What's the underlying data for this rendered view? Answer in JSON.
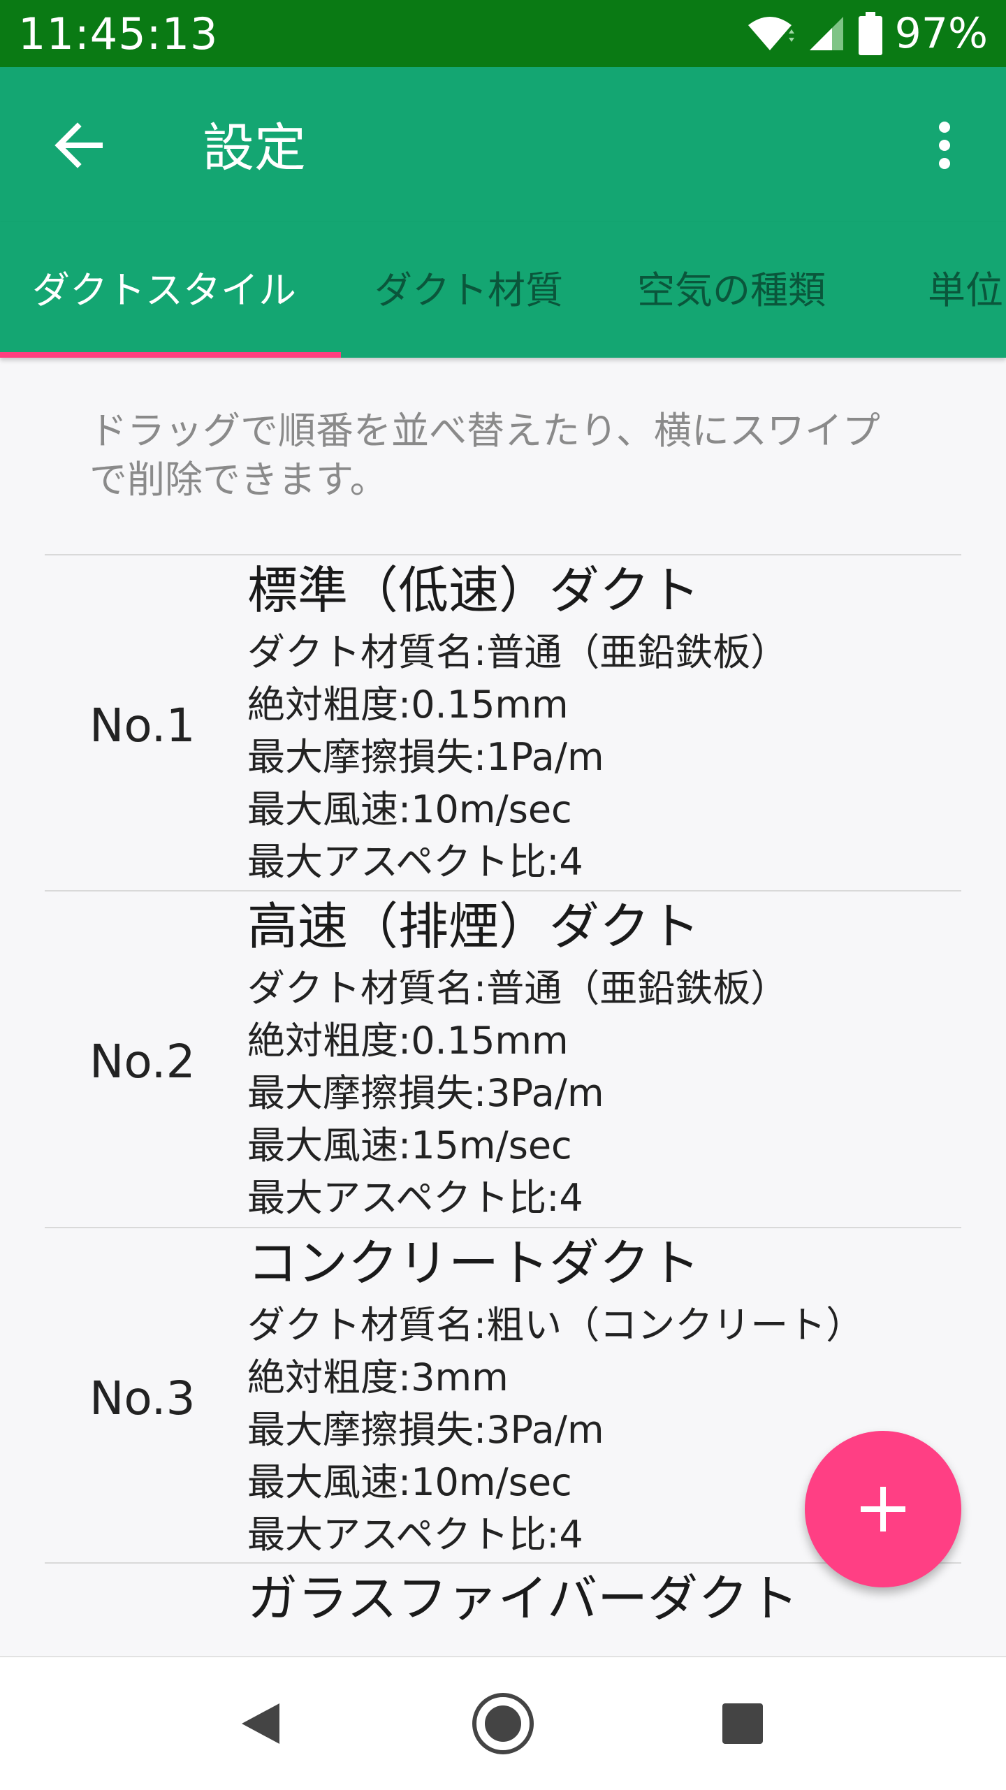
{
  "status_bar": {
    "time": "11:45:13",
    "battery": "97%"
  },
  "app_bar": {
    "title": "設定"
  },
  "tabs": [
    {
      "label": "ダクトスタイル",
      "active": true
    },
    {
      "label": "ダクト材質",
      "active": false
    },
    {
      "label": "空気の種類",
      "active": false
    },
    {
      "label": "単位",
      "active": false
    }
  ],
  "hint": "ドラッグで順番を並べ替えたり、横にスワイプで削除できます。",
  "entries": [
    {
      "no": "No.1",
      "name": "標準（低速）ダクト",
      "material": "ダクト材質名:普通（亜鉛鉄板）",
      "roughness": "絶対粗度:0.15mm",
      "friction": "最大摩擦損失:1Pa/m",
      "velocity": "最大風速:10m/sec",
      "aspect": "最大アスペクト比:4"
    },
    {
      "no": "No.2",
      "name": "高速（排煙）ダクト",
      "material": "ダクト材質名:普通（亜鉛鉄板）",
      "roughness": "絶対粗度:0.15mm",
      "friction": "最大摩擦損失:3Pa/m",
      "velocity": "最大風速:15m/sec",
      "aspect": "最大アスペクト比:4"
    },
    {
      "no": "No.3",
      "name": "コンクリートダクト",
      "material": "ダクト材質名:粗い（コンクリート）",
      "roughness": "絶対粗度:3mm",
      "friction": "最大摩擦損失:3Pa/m",
      "velocity": "最大風速:10m/sec",
      "aspect": "最大アスペクト比:4"
    },
    {
      "name": "ガラスファイバーダクト"
    }
  ],
  "fab": {
    "icon": "plus-icon"
  },
  "colors": {
    "status_bar": "#0a7a14",
    "app_bar": "#14a672",
    "accent": "#ff3f84"
  }
}
